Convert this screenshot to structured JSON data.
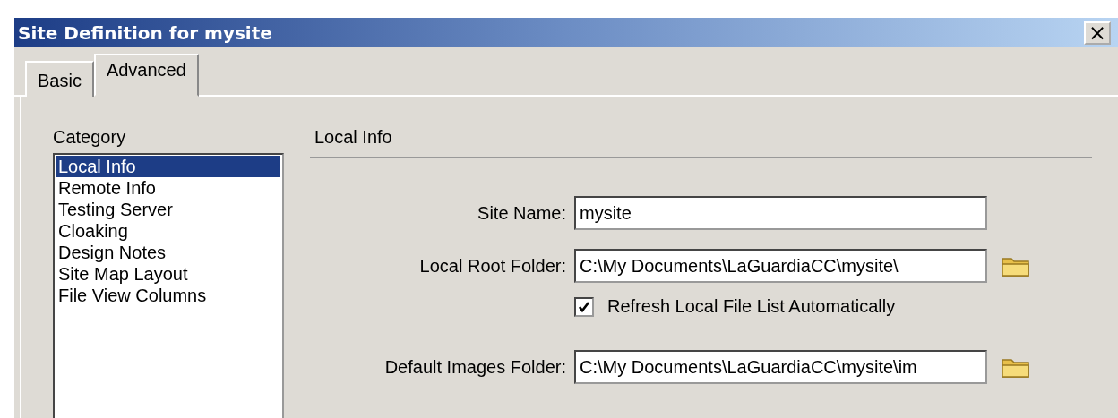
{
  "window": {
    "title": "Site Definition for mysite",
    "close": "×"
  },
  "tabs": [
    {
      "label": "Basic",
      "selected": false
    },
    {
      "label": "Advanced",
      "selected": true
    }
  ],
  "category": {
    "label": "Category",
    "items": [
      {
        "label": "Local Info",
        "selected": true
      },
      {
        "label": "Remote Info",
        "selected": false
      },
      {
        "label": "Testing Server",
        "selected": false
      },
      {
        "label": "Cloaking",
        "selected": false
      },
      {
        "label": "Design Notes",
        "selected": false
      },
      {
        "label": "Site Map Layout",
        "selected": false
      },
      {
        "label": "File View Columns",
        "selected": false
      }
    ]
  },
  "section": {
    "title": "Local Info",
    "rows": [
      {
        "kind": "field",
        "label": "Site Name:",
        "value": "mysite",
        "browse": false
      },
      {
        "kind": "field",
        "label": "Local Root Folder:",
        "value": "C:\\My Documents\\LaGuardiaCC\\mysite\\",
        "browse": true
      },
      {
        "kind": "checkbox",
        "label": "Refresh Local File List Automatically",
        "checked": true
      },
      {
        "kind": "field",
        "label": "Default Images Folder:",
        "value": "C:\\My Documents\\LaGuardiaCC\\mysite\\im",
        "browse": true
      }
    ]
  }
}
